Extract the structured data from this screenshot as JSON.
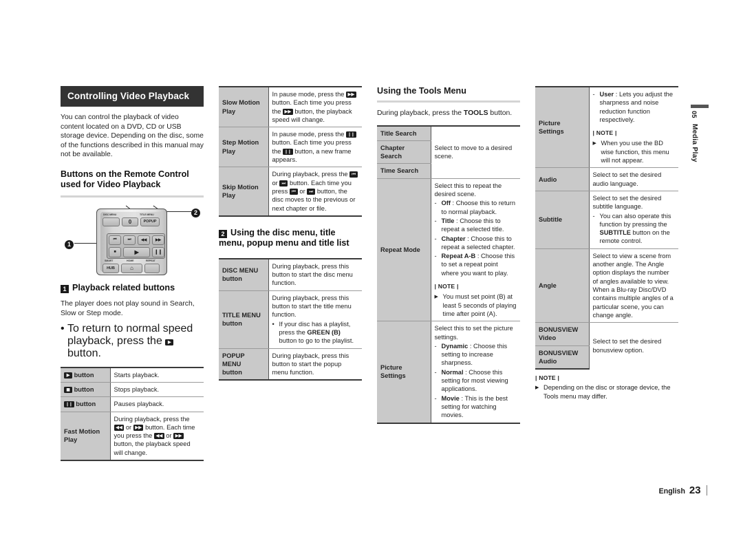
{
  "page": {
    "language": "English",
    "number": "23"
  },
  "side_tab": {
    "chapter_number": "05",
    "chapter_title": "Media Play"
  },
  "col1": {
    "section_header": "Controlling Video Playback",
    "intro": "You can control the playback of video content located on a DVD, CD or USB storage device. Depending on the disc, some of the functions described in this manual may not be available.",
    "subheading": "Buttons on the Remote Control used for Video Playback",
    "callout_1": "1",
    "callout_2": "2",
    "remote": {
      "label_disc_menu": "DISC MENU",
      "label_title_menu": "TITLE MENU",
      "btn_zero": "0",
      "btn_popup": "POPUP",
      "label_smart": "SMART",
      "label_home": "HOME",
      "label_repeat": "REPEAT",
      "btn_hub": "HUB",
      "btn_home_icon": "home-icon",
      "glyph_prev": "⏮",
      "glyph_next": "⏭",
      "glyph_rew": "◀◀",
      "glyph_ff": "▶▶",
      "glyph_stop": "■",
      "glyph_play": "▶",
      "glyph_pause": "❙❙"
    },
    "marker_1": "1",
    "playback_heading": "Playback related buttons",
    "playback_text": "The player does not play sound in Search, Slow or Step mode.",
    "playback_bullet": "To return to normal speed playback, press the",
    "playback_bullet_end": "button.",
    "table": [
      {
        "label_key": "▶",
        "label_suffix": "button",
        "desc": "Starts playback."
      },
      {
        "label_key": "■",
        "label_suffix": "button",
        "desc": "Stops playback."
      },
      {
        "label_key": "❙❙",
        "label_suffix": "button",
        "desc": "Pauses playback."
      }
    ],
    "fast_motion": {
      "label": "Fast Motion Play",
      "line1a": "During playback, press the",
      "line1b": "or",
      "line1c": "button.",
      "line2a": "Each time you press the",
      "line2b": "or",
      "line2c": "button, the playback speed will change.",
      "key_rew": "◀◀",
      "key_ff": "▶▶"
    }
  },
  "col2": {
    "slow_motion": {
      "label": "Slow Motion Play",
      "line1a": "In pause mode, press the",
      "line1b": "button.",
      "line2a": "Each time you press the",
      "line2b": "button, the playback speed will change.",
      "key": "▶▶"
    },
    "step_motion": {
      "label": "Step Motion Play",
      "line1a": "In pause mode, press the",
      "line1b": "button.",
      "line2a": "Each time you press the",
      "line2b": "button, a new frame appears.",
      "key": "❙❙"
    },
    "skip_motion": {
      "label": "Skip Motion Play",
      "line1a": "During playback, press the",
      "line1b": "or",
      "line1c": "button.",
      "line2a": "Each time you press",
      "line2b": "or",
      "line2c": "button, the disc moves to the previous or next chapter or file.",
      "key_prev": "⏮",
      "key_next": "⏭"
    },
    "marker_2": "2",
    "menu_heading": "Using the disc menu, title menu, popup menu and title list",
    "menu_table": [
      {
        "label_main": "DISC MENU",
        "label_sub": "button",
        "desc": "During playback, press this button to start the disc menu function.",
        "bullet": null
      },
      {
        "label_main": "TITLE MENU",
        "label_sub": "button",
        "desc": "During playback, press this button to start the title menu function.",
        "bullet_pre": "If your disc has a playlist, press the",
        "bullet_bold": "GREEN (B)",
        "bullet_post": "button to go to the playlist."
      },
      {
        "label_main": "POPUP MENU",
        "label_sub": "button",
        "desc": "During playback, press this button to start the popup menu function.",
        "bullet": null
      }
    ]
  },
  "col3": {
    "tools_title": "Using the Tools Menu",
    "tools_intro_pre": "During playback, press the",
    "tools_intro_bold": "TOOLS",
    "tools_intro_post": "button.",
    "search_rows": [
      "Title Search",
      "Chapter Search",
      "Time Search"
    ],
    "search_desc": "Select to move to a desired scene.",
    "repeat": {
      "label": "Repeat Mode",
      "intro": "Select this to repeat the desired scene.",
      "options": [
        {
          "name": "Off",
          "text": ": Choose this to return to normal playback."
        },
        {
          "name": "Title",
          "text": ": Choose this to repeat a selected title."
        },
        {
          "name": "Chapter",
          "text": ": Choose this to repeat a selected chapter."
        },
        {
          "name": "Repeat A-B",
          "text": ": Choose this to set a repeat point where you want to play."
        }
      ],
      "note_head": "| NOTE |",
      "note_text": "You must set point (B) at least 5 seconds of playing time after point (A)."
    },
    "picture": {
      "label": "Picture Settings",
      "intro": "Select this to set the picture settings.",
      "options": [
        {
          "name": "Dynamic",
          "text": ": Choose this setting to increase sharpness."
        },
        {
          "name": "Normal",
          "text": ": Choose this setting for most viewing applications."
        },
        {
          "name": "Movie",
          "text": ": This is the best setting for watching movies."
        }
      ]
    }
  },
  "col4": {
    "picture": {
      "label": "Picture Settings",
      "option": {
        "name": "User",
        "text": ": Lets you adjust the sharpness and noise reduction function respectively."
      },
      "note_head": "| NOTE |",
      "note_text": "When you use the BD wise function, this menu will not appear."
    },
    "audio": {
      "label": "Audio",
      "desc": "Select to set the desired audio language."
    },
    "subtitle": {
      "label": "Subtitle",
      "desc": "Select to set the desired subtitle language.",
      "dash_pre": "You can also operate this function by pressing the",
      "dash_bold": "SUBTITLE",
      "dash_post": "button on the remote control."
    },
    "angle": {
      "label": "Angle",
      "desc": "Select to view a scene from another angle. The Angle option displays the number of angles available to view. When a Blu-ray Disc/DVD contains multiple angles of a particular scene, you can change angle."
    },
    "bonusview": {
      "label_video_main": "BONUSVIEW",
      "label_video_sub": "Video",
      "label_audio_main": "BONUSVIEW",
      "label_audio_sub": "Audio",
      "desc": "Select to set the desired bonusview option."
    },
    "final_note": {
      "head": "| NOTE |",
      "text": "Depending on the disc or storage device, the Tools menu may differ."
    }
  }
}
